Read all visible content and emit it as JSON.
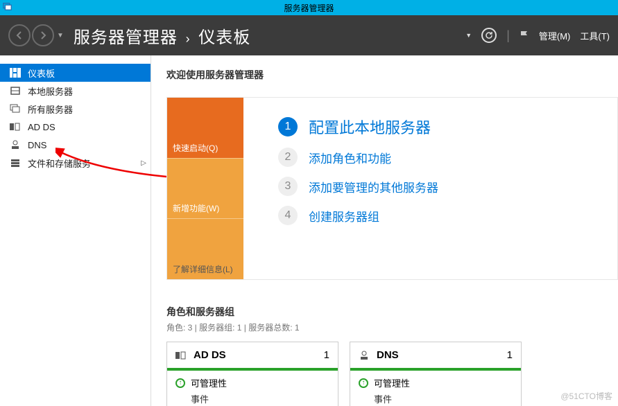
{
  "window_title": "服务器管理器",
  "breadcrumb": {
    "app": "服务器管理器",
    "page": "仪表板",
    "sep": "•"
  },
  "header_menu": {
    "manage": "管理(M)",
    "tools": "工具(T)"
  },
  "sidebar": {
    "items": [
      {
        "label": "仪表板",
        "icon": "dashboard",
        "active": true
      },
      {
        "label": "本地服务器",
        "icon": "server"
      },
      {
        "label": "所有服务器",
        "icon": "servers"
      },
      {
        "label": "AD DS",
        "icon": "ad"
      },
      {
        "label": "DNS",
        "icon": "dns"
      },
      {
        "label": "文件和存储服务",
        "icon": "storage",
        "has_submenu": true
      }
    ]
  },
  "welcome": {
    "title": "欢迎使用服务器管理器",
    "tiles": {
      "q": "快速启动(Q)",
      "w": "新增功能(W)",
      "l": "了解详细信息(L)"
    },
    "steps": [
      {
        "n": "1",
        "label": "配置此本地服务器",
        "primary": true
      },
      {
        "n": "2",
        "label": "添加角色和功能"
      },
      {
        "n": "3",
        "label": "添加要管理的其他服务器"
      },
      {
        "n": "4",
        "label": "创建服务器组"
      }
    ]
  },
  "roles_section": {
    "title": "角色和服务器组",
    "subtitle": "角色: 3 | 服务器组: 1 | 服务器总数: 1",
    "tiles": [
      {
        "name": "AD DS",
        "count": "1",
        "status": "可管理性",
        "row2": "事件",
        "icon": "ad"
      },
      {
        "name": "DNS",
        "count": "1",
        "status": "可管理性",
        "row2": "事件",
        "icon": "dns"
      }
    ]
  },
  "watermark": "@51CTO博客"
}
